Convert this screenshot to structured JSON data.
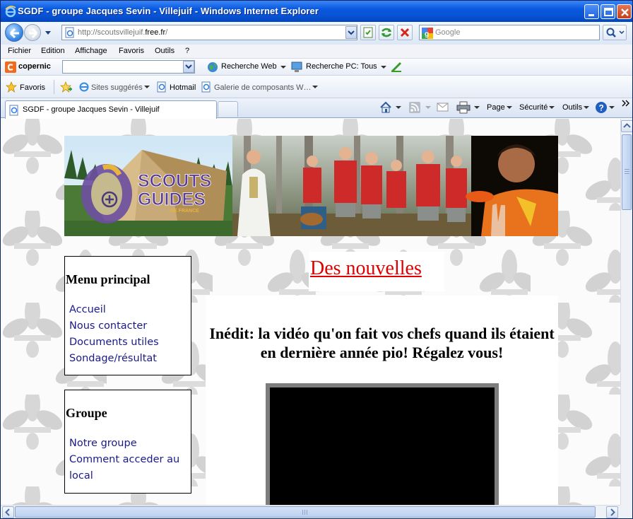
{
  "window": {
    "title": "SGDF - groupe Jacques Sevin - Villejuif - Windows Internet Explorer"
  },
  "nav": {
    "url_prefix": "http://scoutsvillejuif.",
    "url_domain": "free.fr",
    "url_suffix": "/",
    "search_placeholder": "Google"
  },
  "menu": [
    "Fichier",
    "Edition",
    "Affichage",
    "Favoris",
    "Outils",
    "?"
  ],
  "copernic": {
    "logo": "copernic",
    "web_search": "Recherche Web",
    "pc_search": "Recherche PC: Tous"
  },
  "favorites": {
    "label": "Favoris",
    "suggested": "Sites suggérés",
    "hotmail": "Hotmail",
    "gallery": "Galerie de composants W…"
  },
  "tab": {
    "title": "SGDF - groupe Jacques Sevin - Villejuif"
  },
  "command": {
    "page": "Page",
    "security": "Sécurité",
    "tools": "Outils"
  },
  "page": {
    "logo_line1": "SCOUTS",
    "logo_line2": "GUIDES",
    "logo_line3": "DE FRANCE",
    "main_menu_title": "Menu principal",
    "main_menu": [
      "Accueil",
      "Nous contacter",
      "Documents utiles",
      "Sondage/résultat"
    ],
    "group_title": "Groupe",
    "group_menu": [
      "Notre groupe",
      "Comment acceder au local"
    ],
    "news_title": "Des nouvelles",
    "article_heading": "Inédit: la vidéo qu'on fait vos chefs quand ils étaient en dernière année pio! Régalez vous!"
  },
  "colors": {
    "titlebar": "#0858e0",
    "news_title": "#e00000",
    "menu_link": "#1a1a8a"
  }
}
